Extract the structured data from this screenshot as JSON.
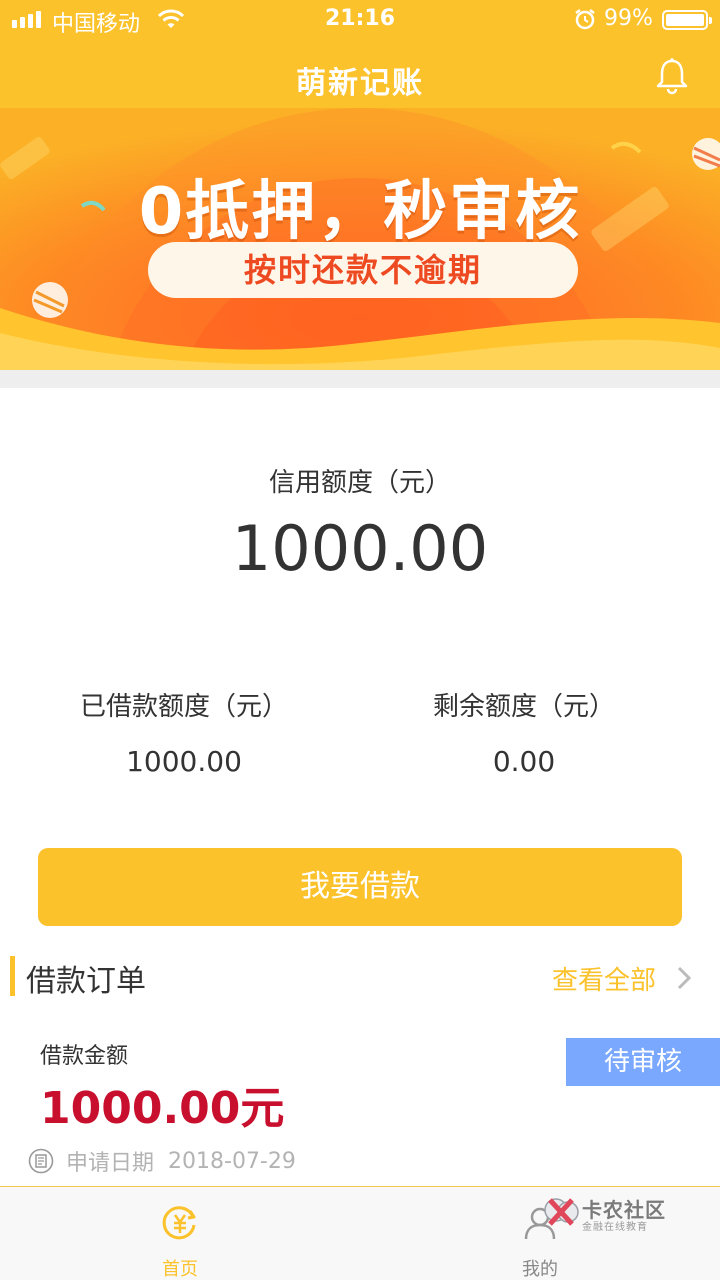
{
  "status_bar": {
    "carrier": "中国移动",
    "time": "21:16",
    "battery": "99%"
  },
  "nav": {
    "title": "萌新记账"
  },
  "banner": {
    "title": "0抵押，秒审核",
    "subtitle": "按时还款不逾期"
  },
  "credit": {
    "label": "信用额度（元）",
    "value": "1000.00",
    "borrowed_label": "已借款额度（元）",
    "borrowed_value": "1000.00",
    "remaining_label": "剩余额度（元）",
    "remaining_value": "0.00"
  },
  "borrow_button": "我要借款",
  "orders": {
    "title": "借款订单",
    "view_all": "查看全部",
    "item": {
      "amount_label": "借款金额",
      "amount": "1000.00元",
      "status": "待审核",
      "date_label": "申请日期",
      "date": "2018-07-29"
    }
  },
  "tabs": [
    {
      "label": "首页",
      "active": true
    },
    {
      "label": "我的",
      "active": false
    }
  ],
  "watermark": {
    "title": "卡农社区",
    "subtitle": "金融在线教育"
  },
  "colors": {
    "brand": "#fcc22c",
    "amount_red": "#c8102e",
    "status_blue": "#7aa8ff"
  }
}
